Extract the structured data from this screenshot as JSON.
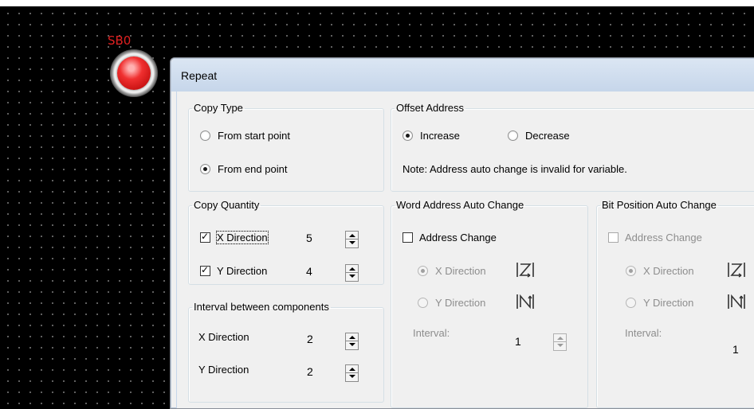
{
  "canvas": {
    "component_label": "SB0",
    "lamp_color": "#e02020"
  },
  "dialog": {
    "title": "Repeat",
    "copy_type": {
      "legend": "Copy Type",
      "options": [
        "From start point",
        "From end point"
      ],
      "selected": "From end point"
    },
    "offset_address": {
      "legend": "Offset Address",
      "options": [
        "Increase",
        "Decrease"
      ],
      "selected": "Increase",
      "note": "Note: Address auto change is invalid for variable."
    },
    "copy_quantity": {
      "legend": "Copy Quantity",
      "x": {
        "label": "X Direction",
        "checked": true,
        "value": "5"
      },
      "y": {
        "label": "Y Direction",
        "checked": true,
        "value": "4"
      }
    },
    "interval": {
      "legend": "Interval between components",
      "x": {
        "label": "X Direction",
        "value": "2"
      },
      "y": {
        "label": "Y Direction",
        "value": "2"
      }
    },
    "word_address": {
      "legend": "Word Address Auto Change",
      "address_change": "Address Change",
      "x_direction": "X Direction",
      "y_direction": "Y Direction",
      "interval_label": "Interval:",
      "interval_value": "1",
      "x_icon": "z-pattern-icon",
      "y_icon": "n-pattern-icon"
    },
    "bit_position": {
      "legend": "Bit Position Auto Change",
      "address_change": "Address Change",
      "x_direction": "X Direction",
      "y_direction": "Y Direction",
      "interval_label": "Interval:",
      "interval_value": "1",
      "x_icon": "z-pattern-icon",
      "y_icon": "n-pattern-icon"
    }
  }
}
